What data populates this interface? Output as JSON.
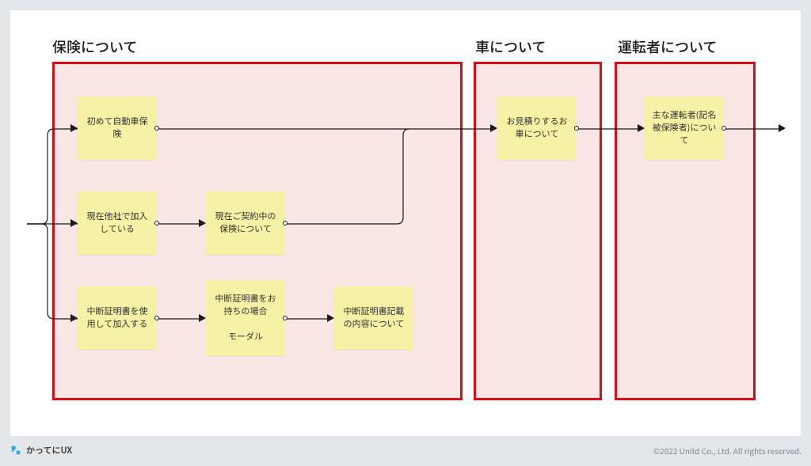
{
  "sections": {
    "insurance": "保険について",
    "car": "車について",
    "driver": "運転者について"
  },
  "notes": {
    "first_time": "初めて自動車保険",
    "other_company": "現在他社で加入している",
    "current_contract": "現在ご契約中の保険について",
    "has_suspension": "中断証明書を使用して加入する",
    "suspension_modal": "中断証明書をお持ちの場合\n\nモーダル",
    "suspension_contents": "中断証明書記載の内容について",
    "car_quote": "お見積りするお車について",
    "main_driver": "主な運転者(記名被保険者)について"
  },
  "brand": "かってにUX",
  "copyright": "©2022 Unitd Co., Ltd. All rights reserved."
}
